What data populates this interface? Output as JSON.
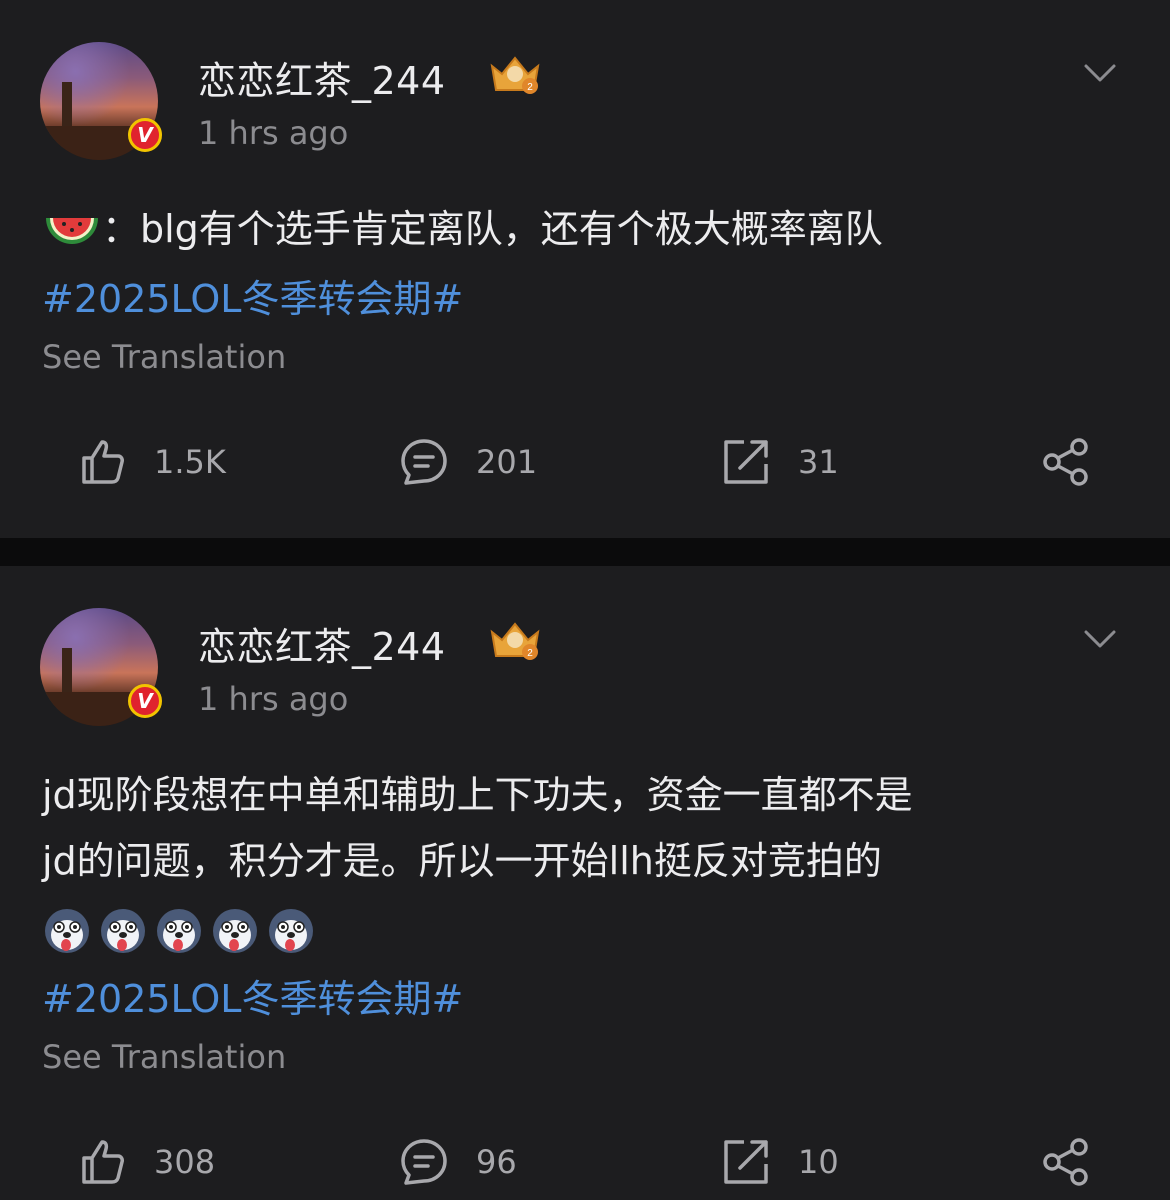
{
  "posts": [
    {
      "username": "恋恋红茶_244",
      "timestamp": "1 hrs ago",
      "content_line1": "：blg有个选手肯定离队，还有个极大概率离队",
      "lead_emoji": "watermelon-emoji",
      "hashtag": "#2025LOL冬季转会期#",
      "see_translation": "See Translation",
      "likes": "1.5K",
      "comments": "201",
      "reposts": "31"
    },
    {
      "username": "恋恋红茶_244",
      "timestamp": "1 hrs ago",
      "content_line1": "jd现阶段想在中单和辅助上下功夫，资金一直都不是",
      "content_line2": "jd的问题，积分才是。所以一开始llh挺反对竞拍的",
      "emoji_count": 5,
      "hashtag": "#2025LOL冬季转会期#",
      "see_translation": "See Translation",
      "likes": "308",
      "comments": "96",
      "reposts": "10"
    }
  ],
  "colors": {
    "background": "#1d1d1f",
    "divider": "#0b0b0c",
    "hashtag": "#4f8fdb",
    "muted": "#8c8c90",
    "verified_badge": "#e0232e"
  },
  "icons": {
    "like": "thumbs-up-icon",
    "comment": "comment-bubble-icon",
    "repost": "repost-arrow-icon",
    "share": "share-nodes-icon",
    "more": "chevron-down-icon",
    "verified": "verified-v-badge-icon",
    "crown": "crown-badge-icon"
  }
}
